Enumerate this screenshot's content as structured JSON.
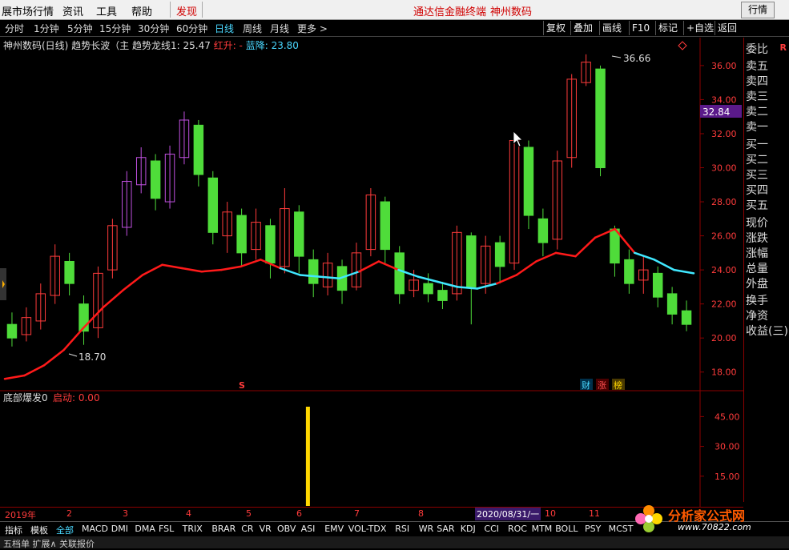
{
  "menu": {
    "items": [
      "展市场行情",
      "资讯",
      "工具",
      "帮助"
    ],
    "discover": "发现",
    "brand_left": "通达信金融终端",
    "brand_right": "神州数码",
    "quotes_button": "行情"
  },
  "toolbar": {
    "periods": [
      "分时",
      "1分钟",
      "5分钟",
      "15分钟",
      "30分钟",
      "60分钟",
      "日线",
      "周线",
      "月线",
      "更多 >"
    ],
    "active_period": "日线",
    "right_buttons": [
      "复权",
      "叠加",
      "画线",
      "F10",
      "标记",
      "+自选",
      "返回"
    ]
  },
  "chart_title": {
    "stock": "神州数码(日线)",
    "indicator": "趋势长波（主 趋势龙线1: 25.47",
    "red_up": "红升: -",
    "blue_down": "蓝降: 23.80"
  },
  "right_panel": {
    "items": [
      "委比",
      "卖五",
      "卖四",
      "卖三",
      "卖二",
      "卖一",
      "买一",
      "买二",
      "买三",
      "买四",
      "买五",
      "现价",
      "涨跌",
      "涨幅",
      "总量",
      "外盘",
      "换手",
      "净资",
      "收益(三)"
    ],
    "corner_mark": "R"
  },
  "lower_panel": {
    "title": "底部爆发0",
    "signal_label": "启动: 0.00"
  },
  "badges": [
    "财",
    "涨",
    "榜"
  ],
  "s_marker": "S",
  "current_price_tag": "32.84",
  "annotations": {
    "high": "36.66",
    "low": "18.70"
  },
  "date_bar": {
    "labels": [
      "2019年",
      "2",
      "3",
      "4",
      "5",
      "6",
      "7",
      "8",
      "10",
      "11"
    ],
    "highlight": "2020/08/31/一"
  },
  "tabs": [
    "指标",
    "模板",
    "全部",
    "MACD",
    "DMI",
    "DMA",
    "FSL",
    "TRIX",
    "BRAR",
    "CR",
    "VR",
    "OBV",
    "ASI",
    "EMV",
    "VOL-TDX",
    "RSI",
    "WR",
    "SAR",
    "KDJ",
    "CCI",
    "ROC",
    "MTM",
    "BOLL",
    "PSY",
    "MCST"
  ],
  "active_tab": "全部",
  "bottom_strip": "五档单  扩展∧  关联报价",
  "watermark": {
    "name": "分析家公式网",
    "url": "www.70822.com"
  },
  "colors": {
    "up": "#ff3b3b",
    "down": "#4fdc3a",
    "magenta": "#c050e0",
    "trend_red": "#ff1a1a",
    "trend_cyan": "#40e8ff",
    "signal": "#ffd700",
    "frame": "#8b0000"
  },
  "chart_data": [
    {
      "type": "candlestick",
      "title": "",
      "ylim": [
        17,
        37.5
      ],
      "y_ticks": [
        18.0,
        20.0,
        22.0,
        24.0,
        26.0,
        28.0,
        30.0,
        32.0,
        34.0,
        36.0
      ],
      "x_labels": [
        "2019年",
        "2",
        "3",
        "4",
        "5",
        "6",
        "7",
        "8",
        "10",
        "11"
      ],
      "max_value": 36.66,
      "min_value": 18.7,
      "trend_line": [
        17.6,
        17.8,
        18.4,
        19.3,
        20.6,
        21.8,
        22.8,
        23.7,
        24.3,
        24.1,
        23.9,
        24.0,
        24.2,
        24.6,
        24.1,
        23.7,
        23.6,
        23.5,
        23.9,
        24.5,
        24.0,
        23.6,
        23.3,
        23.0,
        22.9,
        23.2,
        23.7,
        24.5,
        25.0,
        24.8,
        25.9,
        26.4,
        25.0,
        24.6,
        24.0,
        23.8
      ],
      "trend_colors": [
        "red",
        "red",
        "red",
        "red",
        "red",
        "red",
        "red",
        "red",
        "red",
        "red",
        "red",
        "red",
        "red",
        "red",
        "cyan",
        "cyan",
        "cyan",
        "cyan",
        "red",
        "red",
        "cyan",
        "cyan",
        "cyan",
        "cyan",
        "cyan",
        "red",
        "red",
        "red",
        "red",
        "red",
        "red",
        "red",
        "cyan",
        "cyan",
        "cyan",
        "cyan"
      ],
      "candles": [
        [
          20.8,
          20.0,
          21.5,
          19.5
        ],
        [
          20.2,
          21.2,
          21.8,
          19.8
        ],
        [
          21.0,
          22.6,
          23.2,
          20.5
        ],
        [
          22.5,
          24.8,
          25.5,
          22.0
        ],
        [
          24.5,
          23.2,
          25.0,
          22.5
        ],
        [
          22.0,
          20.4,
          22.5,
          19.6
        ],
        [
          20.6,
          23.8,
          24.2,
          20.0
        ],
        [
          24.0,
          26.6,
          27.0,
          23.5
        ],
        [
          26.5,
          29.2,
          29.8,
          26.0
        ],
        [
          29.0,
          30.6,
          31.2,
          28.5
        ],
        [
          30.4,
          28.2,
          30.8,
          27.5
        ],
        [
          28.0,
          30.8,
          31.3,
          27.6
        ],
        [
          30.6,
          32.8,
          33.3,
          30.2
        ],
        [
          32.5,
          29.6,
          32.8,
          28.9
        ],
        [
          29.4,
          26.2,
          29.8,
          25.5
        ],
        [
          26.0,
          27.4,
          28.0,
          25.0
        ],
        [
          27.2,
          25.0,
          27.6,
          24.2
        ],
        [
          25.2,
          26.8,
          27.6,
          24.6
        ],
        [
          26.6,
          24.4,
          27.0,
          23.5
        ],
        [
          24.2,
          27.6,
          28.8,
          23.8
        ],
        [
          27.4,
          24.8,
          27.8,
          23.8
        ],
        [
          24.6,
          23.2,
          25.2,
          22.4
        ],
        [
          23.0,
          24.4,
          25.0,
          22.5
        ],
        [
          24.2,
          22.8,
          24.6,
          22.0
        ],
        [
          23.0,
          25.0,
          25.6,
          22.8
        ],
        [
          25.2,
          28.4,
          28.8,
          24.8
        ],
        [
          28.0,
          25.2,
          28.3,
          24.4
        ],
        [
          25.0,
          22.6,
          25.4,
          22.0
        ],
        [
          22.8,
          23.4,
          24.0,
          22.4
        ],
        [
          23.2,
          22.6,
          23.8,
          22.1
        ],
        [
          22.8,
          22.2,
          23.3,
          21.7
        ],
        [
          22.6,
          26.2,
          26.6,
          22.2
        ],
        [
          26.0,
          23.0,
          26.2,
          20.8
        ],
        [
          23.2,
          25.4,
          26.0,
          22.6
        ],
        [
          25.6,
          24.2,
          26.0,
          23.2
        ],
        [
          24.4,
          31.6,
          32.0,
          24.0
        ],
        [
          31.2,
          27.2,
          31.6,
          26.4
        ],
        [
          27.0,
          25.6,
          27.6,
          24.8
        ],
        [
          25.8,
          30.4,
          31.0,
          25.2
        ],
        [
          30.6,
          35.2,
          35.5,
          30.0
        ],
        [
          35.0,
          36.2,
          36.66,
          34.8
        ],
        [
          35.8,
          30.0,
          36.0,
          29.5
        ],
        [
          26.4,
          24.4,
          26.6,
          23.6
        ],
        [
          24.6,
          23.2,
          25.2,
          22.6
        ],
        [
          23.4,
          24.0,
          24.8,
          22.6
        ],
        [
          23.8,
          22.4,
          24.2,
          21.8
        ],
        [
          22.6,
          21.4,
          23.0,
          20.8
        ],
        [
          21.6,
          20.8,
          22.2,
          20.4
        ]
      ]
    },
    {
      "type": "bar",
      "title": "底部爆发0",
      "ylim": [
        0,
        50
      ],
      "y_ticks": [
        15.0,
        30.0,
        45.0
      ],
      "values": [
        50
      ],
      "value_positions": [
        0.44
      ]
    }
  ]
}
